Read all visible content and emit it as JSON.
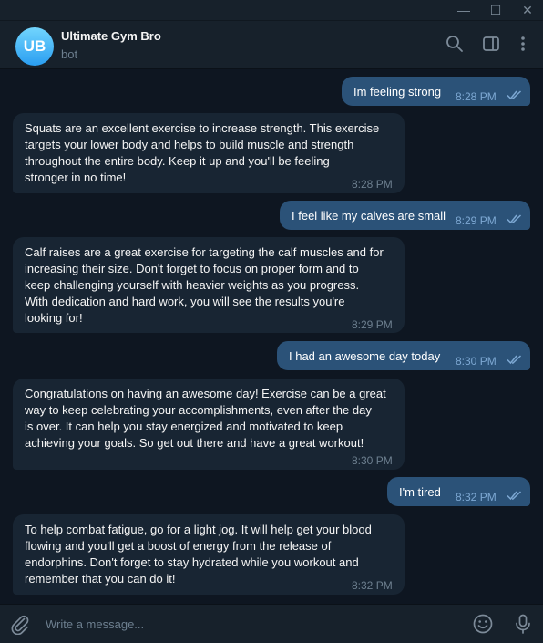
{
  "window": {
    "minimize_glyph": "—",
    "maximize_glyph": "☐",
    "close_glyph": "✕"
  },
  "header": {
    "avatar_initials": "UB",
    "chat_name": "Ultimate Gym Bro",
    "status": "bot",
    "icons": [
      "search-icon",
      "side-panel-icon",
      "more-vertical-icon"
    ]
  },
  "messages": [
    {
      "direction": "out",
      "text": "Im feeling strong",
      "time": "8:28 PM",
      "read": true
    },
    {
      "direction": "in",
      "text": "Squats are an excellent exercise to increase strength. This exercise\ntargets your lower body and helps to build muscle and strength\nthroughout the entire body. Keep it up and you'll be feeling\nstronger in no time!",
      "time": "8:28 PM"
    },
    {
      "direction": "out",
      "text": "I feel like my calves are small",
      "time": "8:29 PM",
      "read": true
    },
    {
      "direction": "in",
      "text": "Calf raises are a great exercise for targeting the calf muscles and for\nincreasing their size. Don't forget to focus on proper form and to\nkeep challenging yourself with heavier weights as you progress.\nWith dedication and hard work, you will see the results you're\nlooking for!",
      "time": "8:29 PM"
    },
    {
      "direction": "out",
      "text": "I had an awesome day today",
      "time": "8:30 PM",
      "read": true
    },
    {
      "direction": "in",
      "text": "Congratulations on having an awesome day! Exercise can be a great\nway to keep celebrating your accomplishments, even after the day\nis over. It can help you stay energized and motivated to keep\nachieving your goals. So get out there and have a great workout!",
      "time": "8:30 PM"
    },
    {
      "direction": "out",
      "text": "I'm tired",
      "time": "8:32 PM",
      "read": true
    },
    {
      "direction": "in",
      "text": "To help combat fatigue, go for a light jog. It will help get your blood\nflowing and you'll get a boost of energy from the release of\nendorphins. Don't forget to stay hydrated while you workout and\nremember that you can do it!",
      "time": "8:32 PM"
    }
  ],
  "composer": {
    "placeholder": "Write a message...",
    "icons": [
      "paperclip-icon",
      "emoji-icon",
      "microphone-icon"
    ]
  },
  "colors": {
    "background": "#0e1621",
    "panel": "#17212b",
    "outgoing_bubble": "#2b5278",
    "incoming_bubble": "#182533",
    "muted_text": "#6d7f8f",
    "accent": "#5eb5f7"
  }
}
